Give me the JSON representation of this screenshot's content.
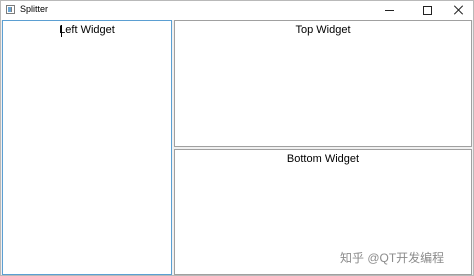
{
  "window": {
    "title": "Splitter",
    "icon": "app-window-icon",
    "controls": {
      "minimize": "minimize-icon",
      "maximize": "maximize-icon",
      "close": "close-icon"
    }
  },
  "panes": {
    "left": {
      "label": "Left Widget"
    },
    "top": {
      "label": "Top Widget"
    },
    "bottom": {
      "label": "Bottom Widget"
    }
  },
  "watermark": {
    "text": "知乎 @QT开发编程"
  },
  "colors": {
    "focus_border": "#5b9fd2",
    "pane_border": "#a0a0a0",
    "pane_background": "#ffffff",
    "window_background": "#f0f0f0"
  }
}
